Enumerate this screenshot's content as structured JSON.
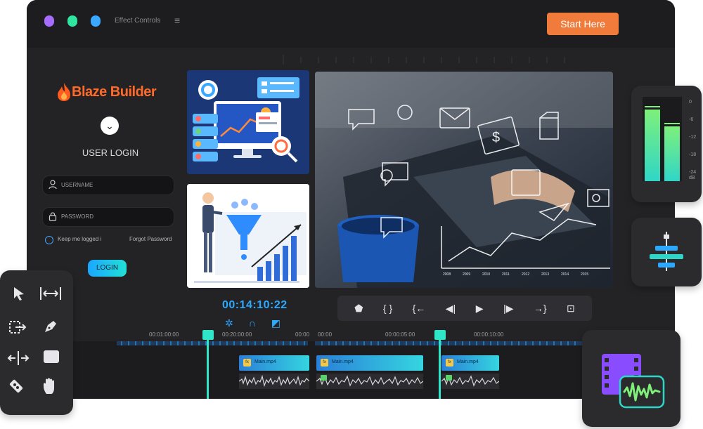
{
  "app": {
    "title": "Effect Controls",
    "window_dots": [
      "#a66cff",
      "#2fe6a0",
      "#3aa8ff"
    ],
    "cta_button": "Start Here",
    "accent": "#2da8ff",
    "cta_color": "#f07b3a"
  },
  "login_panel": {
    "brand": "Blaze Builder",
    "heading": "USER LOGIN",
    "username_placeholder": "USERNAME",
    "password_placeholder": "PASSWORD",
    "remember_label": "Keep me logged i",
    "forgot_label": "Forgot Password",
    "login_button": "LOGIN"
  },
  "preview": {
    "chart_years": [
      "2008",
      "2009",
      "2010",
      "2011",
      "2012",
      "2013",
      "2014",
      "2015"
    ]
  },
  "playback": {
    "timecode": "00:14:10:22",
    "controls": [
      "marker-icon",
      "in-out-icon",
      "go-to-in-icon",
      "step-back-icon",
      "play-icon",
      "step-forward-icon",
      "go-to-out-icon",
      "export-frame-icon"
    ]
  },
  "timeline": {
    "time_labels": [
      "00:01:00:00",
      "00:20:00:00",
      "00:00",
      "00:00",
      "00:00:05:00",
      "00:00:10:00"
    ],
    "clips": [
      {
        "label": "Main.mp4",
        "fx": "fx"
      },
      {
        "label": "Main.mp4",
        "fx": "fx"
      },
      {
        "label": "Main.mp4",
        "fx": "fx"
      }
    ]
  },
  "tools_panel": {
    "tools": [
      "selection-icon",
      "ripple-edit-icon",
      "track-select-icon",
      "pen-icon",
      "slip-icon",
      "rectangle-icon",
      "razor-icon",
      "hand-icon"
    ]
  },
  "audio_meter": {
    "scale": [
      "0",
      "-6",
      "-12",
      "-18",
      "-24",
      "dB"
    ],
    "levels": [
      0.85,
      0.65
    ]
  }
}
